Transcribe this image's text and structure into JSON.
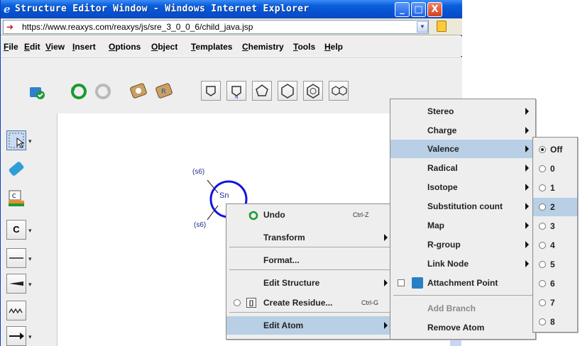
{
  "window": {
    "title": "Structure Editor Window - Windows Internet Explorer",
    "url": "https://www.reaxys.com/reaxys/js/sre_3_0_0_6/child_java.jsp",
    "minimize": "_",
    "maximize": "□",
    "close": "X"
  },
  "menubar": [
    "File",
    "Edit",
    "View",
    "Insert",
    "Options",
    "Object",
    "Templates",
    "Chemistry",
    "Tools",
    "Help"
  ],
  "canvas": {
    "atom_label": "Sn",
    "label_top": "(s6)",
    "label_bottom": "(s6)",
    "left_tool_c": "C"
  },
  "context_menu": {
    "undo": {
      "label": "Undo",
      "shortcut": "Ctrl-Z"
    },
    "transform": "Transform",
    "format": "Format...",
    "edit_structure": "Edit Structure",
    "create_residue": {
      "label": "Create Residue...",
      "shortcut": "Ctrl-G"
    },
    "edit_atom": "Edit Atom"
  },
  "atom_menu": {
    "stereo": "Stereo",
    "charge": "Charge",
    "valence": "Valence",
    "radical": "Radical",
    "isotope": "Isotope",
    "substitution_count": "Substitution count",
    "map": "Map",
    "r_group": "R-group",
    "link_node": "Link Node",
    "attachment_point": "Attachment Point",
    "add_branch": "Add Branch",
    "remove_atom": "Remove Atom"
  },
  "valence_menu": {
    "selected": "Off",
    "highlighted": "2",
    "options": [
      "Off",
      "0",
      "1",
      "2",
      "3",
      "4",
      "5",
      "6",
      "7",
      "8"
    ]
  },
  "colors": {
    "title_bar": "#0a5fdc",
    "menu_highlight": "#b8cfe5",
    "atom_circle": "#1414e0"
  }
}
